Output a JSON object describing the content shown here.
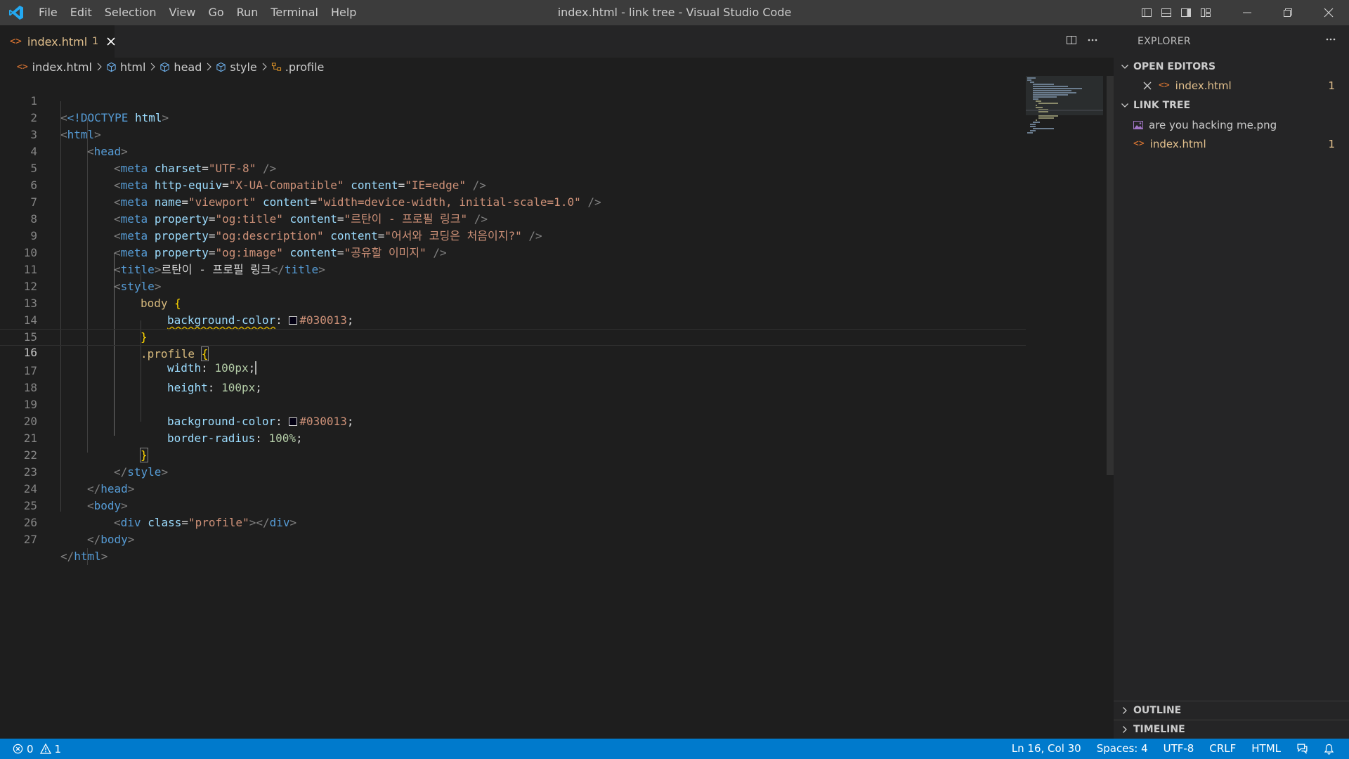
{
  "window": {
    "title": "index.html - link tree - Visual Studio Code",
    "menu": [
      "File",
      "Edit",
      "Selection",
      "View",
      "Go",
      "Run",
      "Terminal",
      "Help"
    ]
  },
  "tab": {
    "label": "index.html",
    "badge": "1"
  },
  "breadcrumb": [
    "index.html",
    "html",
    "head",
    "style",
    ".profile"
  ],
  "editor": {
    "active_line": 16,
    "lines": [
      {
        "n": "1"
      },
      {
        "n": "2"
      },
      {
        "n": "3"
      },
      {
        "n": "4"
      },
      {
        "n": "5"
      },
      {
        "n": "6"
      },
      {
        "n": "7"
      },
      {
        "n": "8"
      },
      {
        "n": "9"
      },
      {
        "n": "10"
      },
      {
        "n": "11"
      },
      {
        "n": "12"
      },
      {
        "n": "13"
      },
      {
        "n": "14"
      },
      {
        "n": "15"
      },
      {
        "n": "16"
      },
      {
        "n": "17"
      },
      {
        "n": "18"
      },
      {
        "n": "19"
      },
      {
        "n": "20"
      },
      {
        "n": "21"
      },
      {
        "n": "22"
      },
      {
        "n": "23"
      },
      {
        "n": "24"
      },
      {
        "n": "25"
      },
      {
        "n": "26"
      },
      {
        "n": "27"
      }
    ],
    "code": {
      "doctype": "<!DOCTYPE",
      "doctype_html": "html",
      "gt": ">",
      "lt": "<",
      "lt_slash": "</",
      "self_close": " />",
      "eq": "=",
      "space": " ",
      "tag_html": "html",
      "tag_head": "head",
      "tag_meta": "meta",
      "tag_title": "title",
      "tag_style": "style",
      "tag_body": "body",
      "tag_div": "div",
      "attr_charset": "charset",
      "attr_http_equiv": "http-equiv",
      "attr_content": "content",
      "attr_name": "name",
      "attr_property": "property",
      "attr_class": "class",
      "val_utf8": "\"UTF-8\"",
      "val_xua": "\"X-UA-Compatible\"",
      "val_ie": "\"IE=edge\"",
      "val_viewport": "\"viewport\"",
      "val_viewport_content": "\"width=device-width, initial-scale=1.0\"",
      "val_og_title": "\"og:title\"",
      "val_og_title_content": "\"르탄이 - 프로필 링크\"",
      "val_og_desc": "\"og:description\"",
      "val_og_desc_content": "\"어서와 코딩은 처음이지?\"",
      "val_og_image": "\"og:image\"",
      "val_og_image_content": "\"공유할 이미지\"",
      "title_text": "르탄이 - 프로필 링크",
      "sel_body": "body",
      "sel_profile": ".profile",
      "brace_open": "{",
      "brace_close": "}",
      "prop_bg": "background-color",
      "prop_width": "width",
      "prop_height": "height",
      "prop_radius": "border-radius",
      "colon": ": ",
      "semi": ";",
      "color_val": "#030013",
      "px100": "100px",
      "pct100": "100%",
      "val_profile": "\"profile\""
    }
  },
  "explorer": {
    "title": "EXPLORER",
    "open_editors": "OPEN EDITORS",
    "open_file": "index.html",
    "open_badge": "1",
    "folder": "LINK TREE",
    "files": [
      {
        "name": "are you hacking me.png",
        "icon": "image-file-icon"
      },
      {
        "name": "index.html",
        "icon": "html-file-icon",
        "badge": "1"
      }
    ],
    "outline": "OUTLINE",
    "timeline": "TIMELINE"
  },
  "status": {
    "errors": "0",
    "warnings": "1",
    "position": "Ln 16, Col 30",
    "spaces": "Spaces: 4",
    "encoding": "UTF-8",
    "eol": "CRLF",
    "language": "HTML"
  },
  "colors": {
    "statusbar": "#007acc",
    "editor_bg": "#1e1e1e",
    "sidebar_bg": "#252526",
    "titlebar_bg": "#3c3c3c",
    "modified": "#e2c08d",
    "swatch": "#030013"
  }
}
